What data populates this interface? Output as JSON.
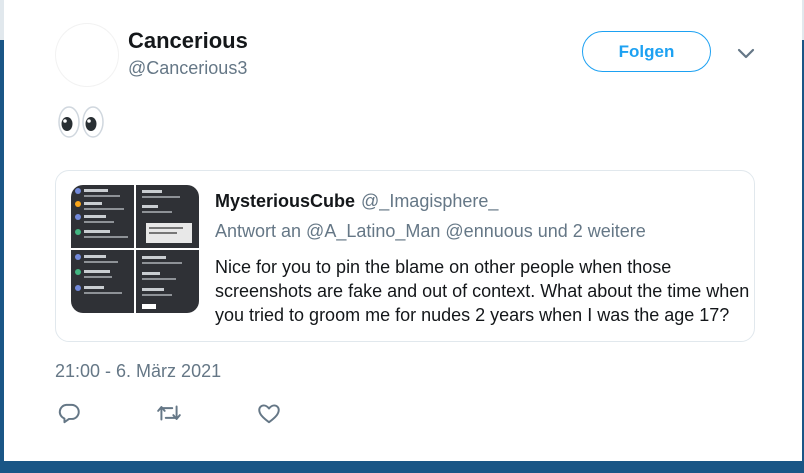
{
  "tweet": {
    "author_name": "Cancerious",
    "author_handle": "@Cancerious3",
    "follow_label": "Folgen",
    "emoji_text": "👀",
    "timestamp": "21:00 - 6. März 2021"
  },
  "quoted_tweet": {
    "author_name": "MysteriousCube",
    "author_handle": "@_Imagisphere_",
    "reply_to": "Antwort an @A_Latino_Man @ennuous und 2 weitere",
    "text_lines": [
      "Nice for you to pin the blame on other people when those",
      "screenshots are fake and out of context. What about the time when",
      "you tried to groom me for nudes 2 years when I was the age 17?"
    ]
  },
  "actions": {
    "icons": [
      "reply-icon",
      "retweet-icon",
      "like-icon"
    ]
  },
  "colors": {
    "accent": "#1da1f2",
    "text_primary": "#14171a",
    "text_secondary": "#657786",
    "border": "#e1e8ed",
    "page_background": "#1a5686"
  }
}
